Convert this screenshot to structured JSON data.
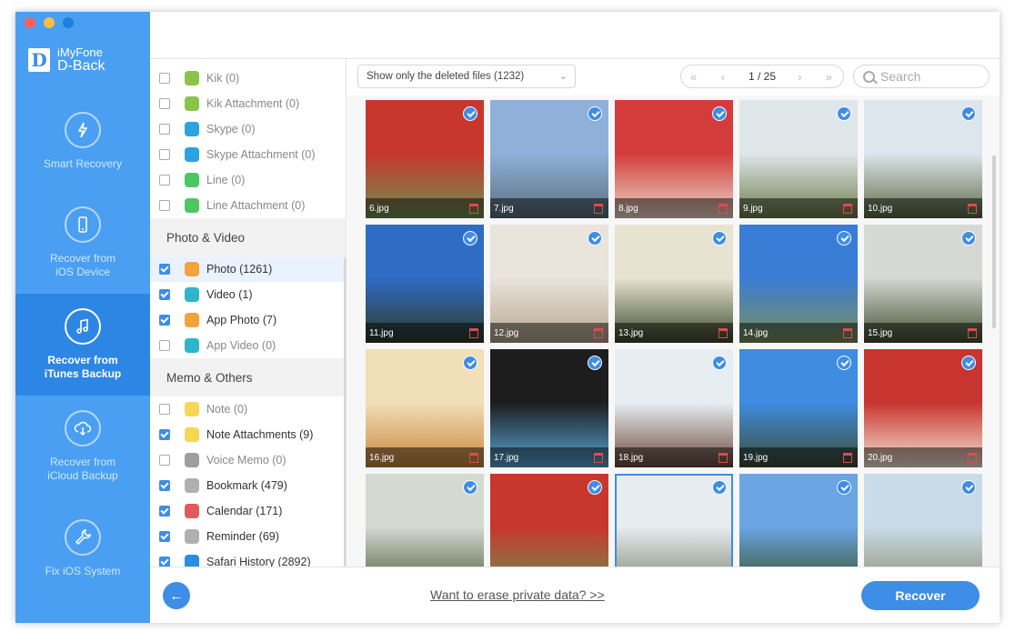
{
  "app": {
    "brand_line1": "iMyFone",
    "brand_line2": "D-Back",
    "logo_letter": "D"
  },
  "sidebar": {
    "items": [
      {
        "label1": "Smart Recovery",
        "label2": "",
        "icon": "lightning-refresh-icon",
        "active": false
      },
      {
        "label1": "Recover from",
        "label2": "iOS Device",
        "icon": "phone-icon",
        "active": false
      },
      {
        "label1": "Recover from",
        "label2": "iTunes Backup",
        "icon": "music-note-icon",
        "active": true
      },
      {
        "label1": "Recover from",
        "label2": "iCloud Backup",
        "icon": "cloud-download-icon",
        "active": false
      },
      {
        "label1": "Fix iOS System",
        "label2": "",
        "icon": "wrench-icon",
        "active": false
      }
    ]
  },
  "categories": {
    "rows_top": [
      {
        "label": "Kik (0)",
        "checked": false,
        "icon": "kik-icon",
        "color": "#8bc34a"
      },
      {
        "label": "Kik Attachment (0)",
        "checked": false,
        "icon": "kik-icon",
        "color": "#8bc34a"
      },
      {
        "label": "Skype (0)",
        "checked": false,
        "icon": "skype-icon",
        "color": "#2aa3e0"
      },
      {
        "label": "Skype Attachment (0)",
        "checked": false,
        "icon": "skype-icon",
        "color": "#2aa3e0"
      },
      {
        "label": "Line (0)",
        "checked": false,
        "icon": "line-icon",
        "color": "#4cc764"
      },
      {
        "label": "Line Attachment (0)",
        "checked": false,
        "icon": "line-icon",
        "color": "#4cc764"
      }
    ],
    "section_photo": "Photo & Video",
    "rows_photo": [
      {
        "label": "Photo (1261)",
        "checked": true,
        "icon": "photos-icon",
        "color": "#f4a23c"
      },
      {
        "label": "Video (1)",
        "checked": true,
        "icon": "video-icon",
        "color": "#2fb5c9"
      },
      {
        "label": "App Photo (7)",
        "checked": true,
        "icon": "photos-icon",
        "color": "#f4a23c"
      },
      {
        "label": "App Video (0)",
        "checked": false,
        "icon": "video-icon",
        "color": "#2fb5c9"
      }
    ],
    "section_memo": "Memo & Others",
    "rows_memo": [
      {
        "label": "Note (0)",
        "checked": false,
        "icon": "note-icon",
        "color": "#f7d656"
      },
      {
        "label": "Note Attachments (9)",
        "checked": true,
        "icon": "note-icon",
        "color": "#f7d656"
      },
      {
        "label": "Voice Memo (0)",
        "checked": false,
        "icon": "voice-memo-icon",
        "color": "#9e9e9e"
      },
      {
        "label": "Bookmark (479)",
        "checked": true,
        "icon": "bookmark-icon",
        "color": "#b0b0b0"
      },
      {
        "label": "Calendar (171)",
        "checked": true,
        "icon": "calendar-icon",
        "color": "#e05b5b"
      },
      {
        "label": "Reminder (69)",
        "checked": true,
        "icon": "reminder-icon",
        "color": "#b0b0b0"
      },
      {
        "label": "Safari History (2892)",
        "checked": true,
        "icon": "safari-icon",
        "color": "#2a8de0"
      }
    ]
  },
  "toolbar": {
    "filter_label": "Show only the deleted files (1232)",
    "page_indicator": "1 / 25",
    "search_placeholder": "Search"
  },
  "photos": [
    {
      "name": "6.jpg",
      "colors": [
        "#c8372c",
        "#6f8f54"
      ]
    },
    {
      "name": "7.jpg",
      "colors": [
        "#8fb1d9",
        "#5a6f7d"
      ]
    },
    {
      "name": "8.jpg",
      "colors": [
        "#d43b3b",
        "#e8d8c8"
      ]
    },
    {
      "name": "9.jpg",
      "colors": [
        "#dfe7ea",
        "#6e7d4a"
      ]
    },
    {
      "name": "10.jpg",
      "colors": [
        "#dce6ec",
        "#5d6a45"
      ]
    },
    {
      "name": "11.jpg",
      "colors": [
        "#2f6cc4",
        "#2f3b2a"
      ]
    },
    {
      "name": "12.jpg",
      "colors": [
        "#e9e4dc",
        "#b7a690"
      ]
    },
    {
      "name": "13.jpg",
      "colors": [
        "#e8e3d0",
        "#3c4a2c"
      ]
    },
    {
      "name": "14.jpg",
      "colors": [
        "#3a7dd6",
        "#7b8f5a"
      ]
    },
    {
      "name": "15.jpg",
      "colors": [
        "#d5d8d3",
        "#41502f"
      ]
    },
    {
      "name": "16.jpg",
      "colors": [
        "#f1dfb8",
        "#c8853a"
      ]
    },
    {
      "name": "17.jpg",
      "colors": [
        "#1d1d1d",
        "#59a6d9"
      ]
    },
    {
      "name": "18.jpg",
      "colors": [
        "#e7eef3",
        "#6c4a3a"
      ]
    },
    {
      "name": "19.jpg",
      "colors": [
        "#3f8ce0",
        "#3d4d33"
      ]
    },
    {
      "name": "20.jpg",
      "colors": [
        "#c8342f",
        "#f2e7d6"
      ]
    },
    {
      "name": "",
      "colors": [
        "#d4d9d2",
        "#4a5a38"
      ]
    },
    {
      "name": "",
      "colors": [
        "#c8372c",
        "#6f8f54"
      ]
    },
    {
      "name": "",
      "colors": [
        "#e6ecef",
        "#7c8470"
      ]
    },
    {
      "name": "",
      "colors": [
        "#6ba5e3",
        "#364d22"
      ]
    },
    {
      "name": "",
      "colors": [
        "#c9dbe9",
        "#8a8c6c"
      ]
    }
  ],
  "footer": {
    "erase_link": "Want to erase private data? >>",
    "recover_label": "Recover"
  }
}
